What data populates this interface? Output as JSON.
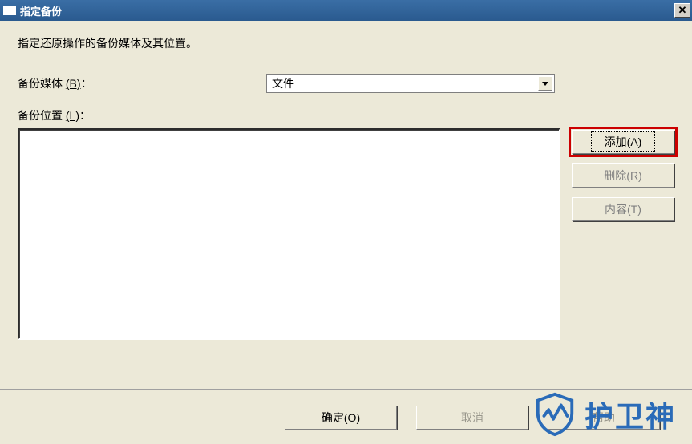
{
  "titlebar": {
    "title": "指定备份"
  },
  "dialog": {
    "instruction": "指定还原操作的备份媒体及其位置。",
    "media_label": "备份媒体",
    "media_hotkey": "(B)",
    "media_value": "文件",
    "location_label": "备份位置",
    "location_hotkey": "(L)"
  },
  "buttons": {
    "add": "添加(A)",
    "remove": "删除(R)",
    "contents": "内容(T)",
    "ok": "确定(O)",
    "cancel": "取消",
    "help": "帮助"
  },
  "watermark": {
    "text": "护卫神"
  }
}
